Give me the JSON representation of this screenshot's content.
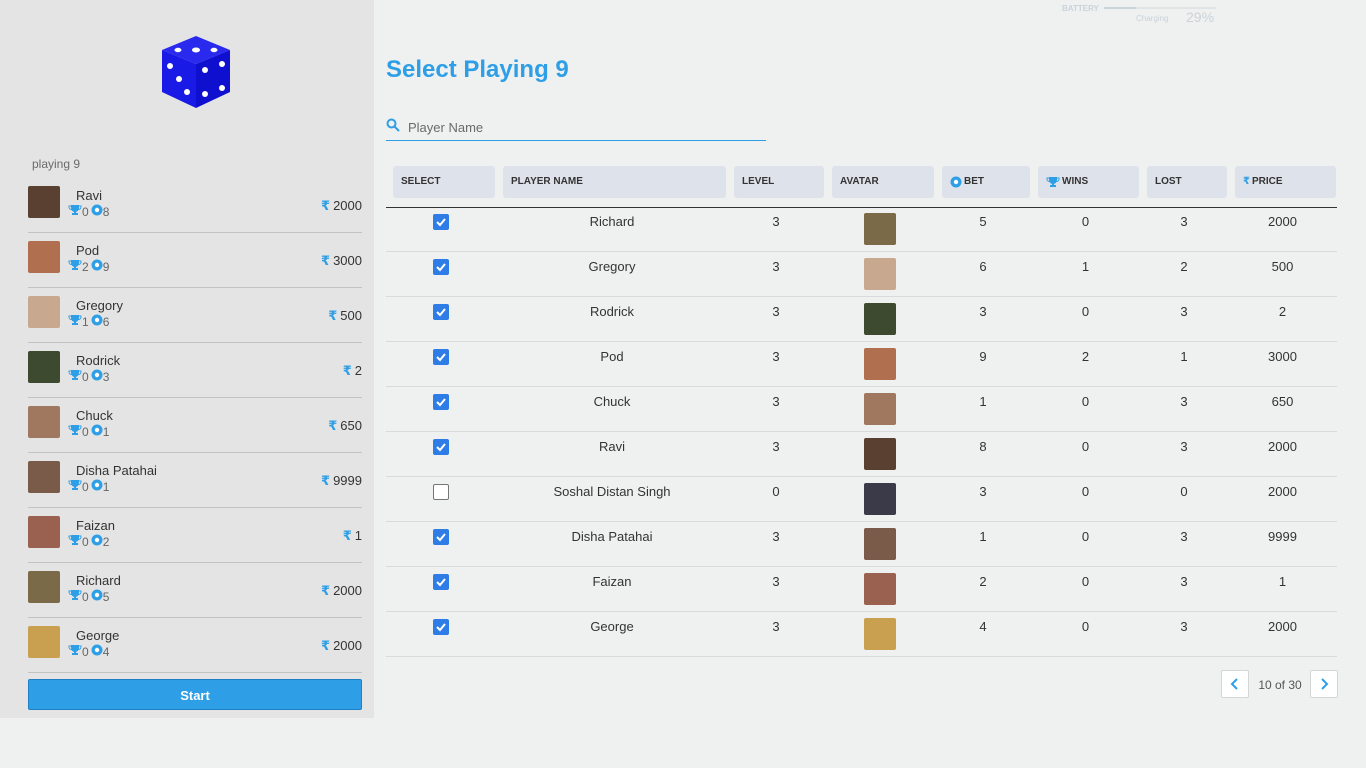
{
  "sidebar": {
    "playing_label": "playing 9",
    "start_label": "Start",
    "players": [
      {
        "name": "Ravi",
        "wins": "0",
        "bets": "8",
        "price": "2000",
        "avatar_color": "#5a4030"
      },
      {
        "name": "Pod",
        "wins": "2",
        "bets": "9",
        "price": "3000",
        "avatar_color": "#b07050"
      },
      {
        "name": "Gregory",
        "wins": "1",
        "bets": "6",
        "price": "500",
        "avatar_color": "#c9a890"
      },
      {
        "name": "Rodrick",
        "wins": "0",
        "bets": "3",
        "price": "2",
        "avatar_color": "#3d4a30"
      },
      {
        "name": "Chuck",
        "wins": "0",
        "bets": "1",
        "price": "650",
        "avatar_color": "#a07860"
      },
      {
        "name": "Disha Patahai",
        "wins": "0",
        "bets": "1",
        "price": "9999",
        "avatar_color": "#7a5a48"
      },
      {
        "name": "Faizan",
        "wins": "0",
        "bets": "2",
        "price": "1",
        "avatar_color": "#9a6050"
      },
      {
        "name": "Richard",
        "wins": "0",
        "bets": "5",
        "price": "2000",
        "avatar_color": "#7a6a48"
      },
      {
        "name": "George",
        "wins": "0",
        "bets": "4",
        "price": "2000",
        "avatar_color": "#c8a050"
      }
    ]
  },
  "battery": {
    "label": "BATTERY",
    "status": "Charging",
    "percent": "29%",
    "level": 0.29
  },
  "main": {
    "title": "Select Playing 9",
    "search": {
      "placeholder": "Player Name",
      "value": ""
    },
    "columns": [
      "SELECT",
      "PLAYER NAME",
      "LEVEL",
      "AVATAR",
      "BET",
      "WINS",
      "LOST",
      "PRICE"
    ],
    "rows": [
      {
        "selected": true,
        "name": "Richard",
        "level": "3",
        "bet": "5",
        "wins": "0",
        "lost": "3",
        "price": "2000",
        "avatar_color": "#7a6a48"
      },
      {
        "selected": true,
        "name": "Gregory",
        "level": "3",
        "bet": "6",
        "wins": "1",
        "lost": "2",
        "price": "500",
        "avatar_color": "#c9a890"
      },
      {
        "selected": true,
        "name": "Rodrick",
        "level": "3",
        "bet": "3",
        "wins": "0",
        "lost": "3",
        "price": "2",
        "avatar_color": "#3d4a30"
      },
      {
        "selected": true,
        "name": "Pod",
        "level": "3",
        "bet": "9",
        "wins": "2",
        "lost": "1",
        "price": "3000",
        "avatar_color": "#b07050"
      },
      {
        "selected": true,
        "name": "Chuck",
        "level": "3",
        "bet": "1",
        "wins": "0",
        "lost": "3",
        "price": "650",
        "avatar_color": "#a07860"
      },
      {
        "selected": true,
        "name": "Ravi",
        "level": "3",
        "bet": "8",
        "wins": "0",
        "lost": "3",
        "price": "2000",
        "avatar_color": "#5a4030"
      },
      {
        "selected": false,
        "name": "Soshal Distan Singh",
        "level": "0",
        "bet": "3",
        "wins": "0",
        "lost": "0",
        "price": "2000",
        "avatar_color": "#3a3a48"
      },
      {
        "selected": true,
        "name": "Disha Patahai",
        "level": "3",
        "bet": "1",
        "wins": "0",
        "lost": "3",
        "price": "9999",
        "avatar_color": "#7a5a48"
      },
      {
        "selected": true,
        "name": "Faizan",
        "level": "3",
        "bet": "2",
        "wins": "0",
        "lost": "3",
        "price": "1",
        "avatar_color": "#9a6050"
      },
      {
        "selected": true,
        "name": "George",
        "level": "3",
        "bet": "4",
        "wins": "0",
        "lost": "3",
        "price": "2000",
        "avatar_color": "#c8a050"
      }
    ],
    "pagination": {
      "text": "10 of 30"
    }
  },
  "colors": {
    "accent": "#2e9fe6",
    "checkbox": "#2e7ce6",
    "dice": "#1a1ae6"
  },
  "icons": {
    "logo": "dice-icon",
    "wins": "trophy-icon",
    "bet": "coin-icon",
    "price": "rupee-icon",
    "search": "search-icon"
  }
}
